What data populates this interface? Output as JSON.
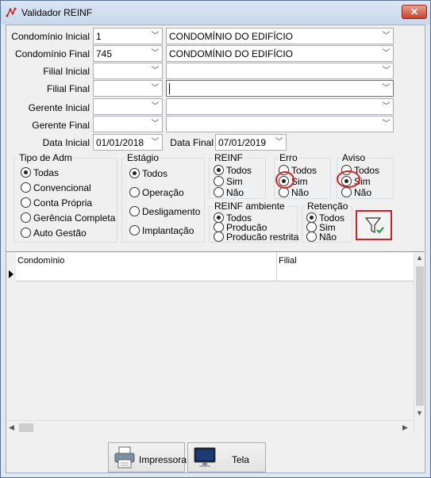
{
  "window": {
    "title": "Validador REINF",
    "close_label": "✕"
  },
  "fields": {
    "condominio_inicial": {
      "label": "Condomínio Inicial",
      "code": "1",
      "name": "CONDOMÍNIO DO EDIFÍCIO"
    },
    "condominio_final": {
      "label": "Condomínio Final",
      "code": "745",
      "name": "CONDOMÍNIO DO EDIFÍCIO"
    },
    "filial_inicial": {
      "label": "Filial Inicial",
      "code": "",
      "name": ""
    },
    "filial_final": {
      "label": "Filial Final",
      "code": "",
      "name": ""
    },
    "gerente_inicial": {
      "label": "Gerente Inicial",
      "code": "",
      "name": ""
    },
    "gerente_final": {
      "label": "Gerente Final",
      "code": "",
      "name": ""
    },
    "data_inicial": {
      "label": "Data Inicial",
      "value": "01/01/2018"
    },
    "data_final": {
      "label": "Data Final",
      "value": "07/01/2019"
    }
  },
  "groups": {
    "tipo_adm": {
      "title": "Tipo de Adm",
      "options": [
        "Todas",
        "Convencional",
        "Conta Própria",
        "Gerência Completa",
        "Auto Gestão"
      ],
      "selected": "Todas"
    },
    "estagio": {
      "title": "Estágio",
      "options": [
        "Todos",
        "Operação",
        "Desligamento",
        "Implantação"
      ],
      "selected": "Todos"
    },
    "reinf": {
      "title": "REINF",
      "options": [
        "Todos",
        "Sim",
        "Não"
      ],
      "selected": "Todos"
    },
    "erro": {
      "title": "Erro",
      "options": [
        "Todos",
        "Sim",
        "Não"
      ],
      "selected": "Sim"
    },
    "aviso": {
      "title": "Aviso",
      "options": [
        "Todos",
        "Sim",
        "Não"
      ],
      "selected": "Sim"
    },
    "reinf_ambiente": {
      "title": "REINF ambiente",
      "options": [
        "Todos",
        "Producão",
        "Producão restrita"
      ],
      "selected": "Todos"
    },
    "retencao": {
      "title": "Retenção",
      "options": [
        "Todos",
        "Sim",
        "Não"
      ],
      "selected": "Todos"
    }
  },
  "grid": {
    "columns": [
      "Condomínio",
      "Filial"
    ]
  },
  "buttons": {
    "impressora": "Impressora",
    "tela": "Tela"
  },
  "colors": {
    "highlight": "#d0202a",
    "titlebar": "#c9d8ec"
  }
}
